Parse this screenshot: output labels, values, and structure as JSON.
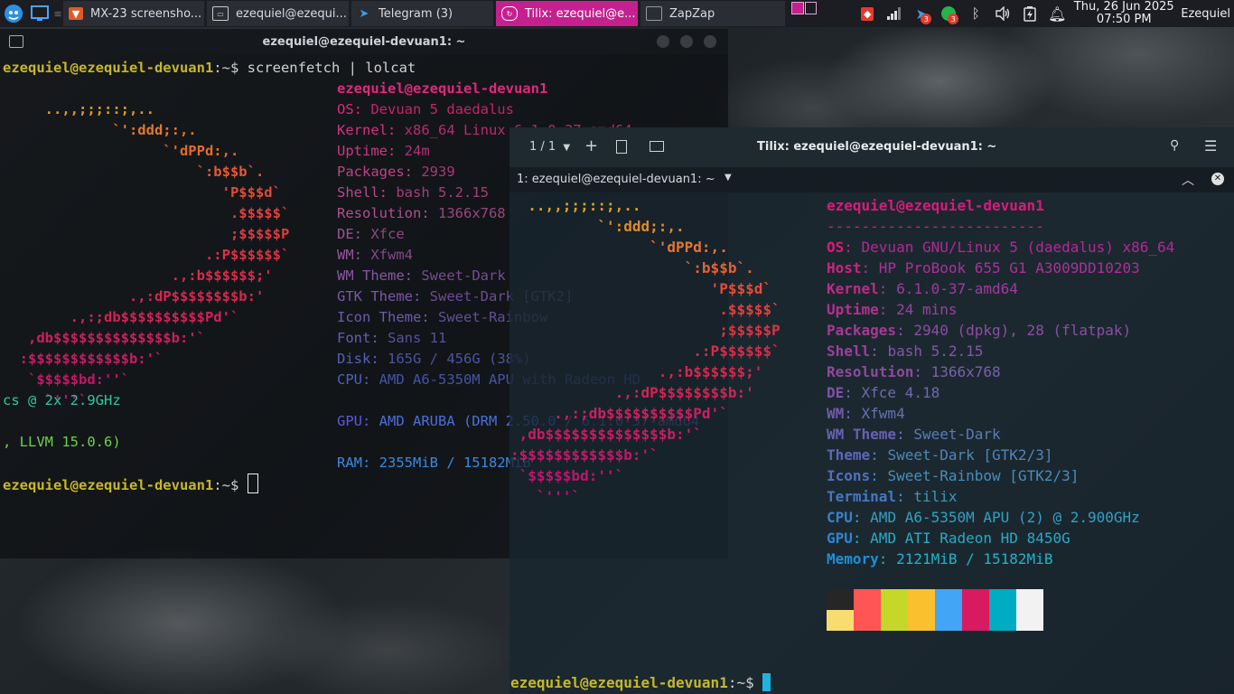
{
  "taskbar": {
    "tasks": [
      {
        "label": "MX-23 screensho..."
      },
      {
        "label": "ezequiel@ezequi..."
      },
      {
        "label": "Telegram (3)"
      },
      {
        "label": "Tilix: ezequiel@e..."
      },
      {
        "label": "ZapZap"
      }
    ],
    "badges": {
      "ic1": "3",
      "ic2": "3"
    },
    "clock_date": "Thu, 26 Jun 2025",
    "clock_time": "07:50 PM",
    "user": "Ezequiel"
  },
  "window1": {
    "title": "ezequiel@ezequiel-devuan1: ~",
    "prompt_user": "ezequiel@ezequiel-devuan1",
    "prompt_rest": ":~$ ",
    "command": "screenfetch | lolcat",
    "ascii": [
      "     ..,,;;;::;,..",
      "             `':ddd;:,.",
      "                   `'dPPd:,.",
      "                       `:b$$b`.",
      "                          'P$$$d`",
      "                           .$$$$$`",
      "                           ;$$$$$P",
      "                        .:P$$$$$$`",
      "                    .,:b$$$$$$;'",
      "               .,:dP$$$$$$$$b:'",
      "        .,:;db$$$$$$$$$$Pd'`",
      "   ,db$$$$$$$$$$$$$$b:'`",
      "  :$$$$$$$$$$$$b:'`",
      "   `$$$$$bd:''`",
      "     `'''`"
    ],
    "info_title": "ezequiel@ezequiel-devuan1",
    "info": [
      {
        "k": "OS:",
        "v": " Devuan 5 daedalus"
      },
      {
        "k": "Kernel:",
        "v": " x86_64 Linux 6.1.0-37-amd64"
      },
      {
        "k": "Uptime:",
        "v": " 24m"
      },
      {
        "k": "Packages:",
        "v": " 2939"
      },
      {
        "k": "Shell:",
        "v": " bash 5.2.15"
      },
      {
        "k": "Resolution:",
        "v": " 1366x768"
      },
      {
        "k": "DE:",
        "v": " Xfce"
      },
      {
        "k": "WM:",
        "v": " Xfwm4"
      },
      {
        "k": "WM Theme:",
        "v": " Sweet-Dark"
      },
      {
        "k": "GTK Theme:",
        "v": " Sweet-Dark [GTK2]"
      },
      {
        "k": "Icon Theme:",
        "v": " Sweet-Rainbow"
      },
      {
        "k": "Font:",
        "v": " Sans 11"
      },
      {
        "k": "Disk:",
        "v": " 165G / 456G (38%)"
      },
      {
        "k": "CPU:",
        "v": " AMD A6-5350M APU with Radeon HD"
      }
    ],
    "cpu_wrap": "cs @ 2x 2.9GHz",
    "gpu": {
      "k": "GPU:",
      "v": " AMD ARUBA (DRM 2.50.0 / 6.1.0-37-amd64"
    },
    "gpu_wrap": ", LLVM 15.0.6)",
    "ram": {
      "k": "RAM:",
      "v": " 2355MiB / 15182MiB"
    }
  },
  "window2": {
    "tab_counter": "1 / 1",
    "title": "Tilix: ezequiel@ezequiel-devuan1: ~",
    "session_label": "1: ezequiel@ezequiel-devuan1: ~",
    "ascii": [
      "  ..,,;;;::;,..",
      "          `':ddd;:,.",
      "                `'dPPd:,.",
      "                    `:b$$b`.",
      "                       'P$$$d`",
      "                        .$$$$$`",
      "                        ;$$$$$P",
      "                     .:P$$$$$$`",
      "                 .,:b$$$$$$;'",
      "            .,:dP$$$$$$$$b:'",
      "     .,:;db$$$$$$$$$$Pd'`",
      " ,db$$$$$$$$$$$$$$b:'`",
      ":$$$$$$$$$$$$b:'`",
      " `$$$$$bd:''`",
      "   `'''`"
    ],
    "info_title": "ezequiel@ezequiel-devuan1",
    "separator": "-------------------------",
    "info": [
      {
        "k": "OS",
        "v": ": Devuan GNU/Linux 5 (daedalus) x86_64"
      },
      {
        "k": "Host",
        "v": ": HP ProBook 655 G1 A3009DD10203"
      },
      {
        "k": "Kernel",
        "v": ": 6.1.0-37-amd64"
      },
      {
        "k": "Uptime",
        "v": ": 24 mins"
      },
      {
        "k": "Packages",
        "v": ": 2940 (dpkg), 28 (flatpak)"
      },
      {
        "k": "Shell",
        "v": ": bash 5.2.15"
      },
      {
        "k": "Resolution",
        "v": ": 1366x768"
      },
      {
        "k": "DE",
        "v": ": Xfce 4.18"
      },
      {
        "k": "WM",
        "v": ": Xfwm4"
      },
      {
        "k": "WM Theme",
        "v": ": Sweet-Dark"
      },
      {
        "k": "Theme",
        "v": ": Sweet-Dark [GTK2/3]"
      },
      {
        "k": "Icons",
        "v": ": Sweet-Rainbow [GTK2/3]"
      },
      {
        "k": "Terminal",
        "v": ": tilix"
      },
      {
        "k": "CPU",
        "v": ": AMD A6-5350M APU (2) @ 2.900GHz"
      },
      {
        "k": "GPU",
        "v": ": AMD ATI Radeon HD 8450G"
      },
      {
        "k": "Memory",
        "v": ": 2121MiB / 15182MiB"
      }
    ],
    "palette_top": [
      "#262626",
      "#ff5555",
      "#c5d829",
      "#fbc02d",
      "#42a5f5",
      "#d81b60",
      "#00acc1",
      "#f2f2f2"
    ],
    "palette_bottom": [
      "#f7dc6f"
    ],
    "prompt_user": "ezequiel@ezequiel-devuan1",
    "prompt_rest": ":~$ "
  },
  "colors": {
    "prompt_user": "#c6b72a",
    "terminal_text": "#d0d0d0",
    "tilix_accent": "#c5208f",
    "cursor_tilix": "#1fb3e0"
  }
}
